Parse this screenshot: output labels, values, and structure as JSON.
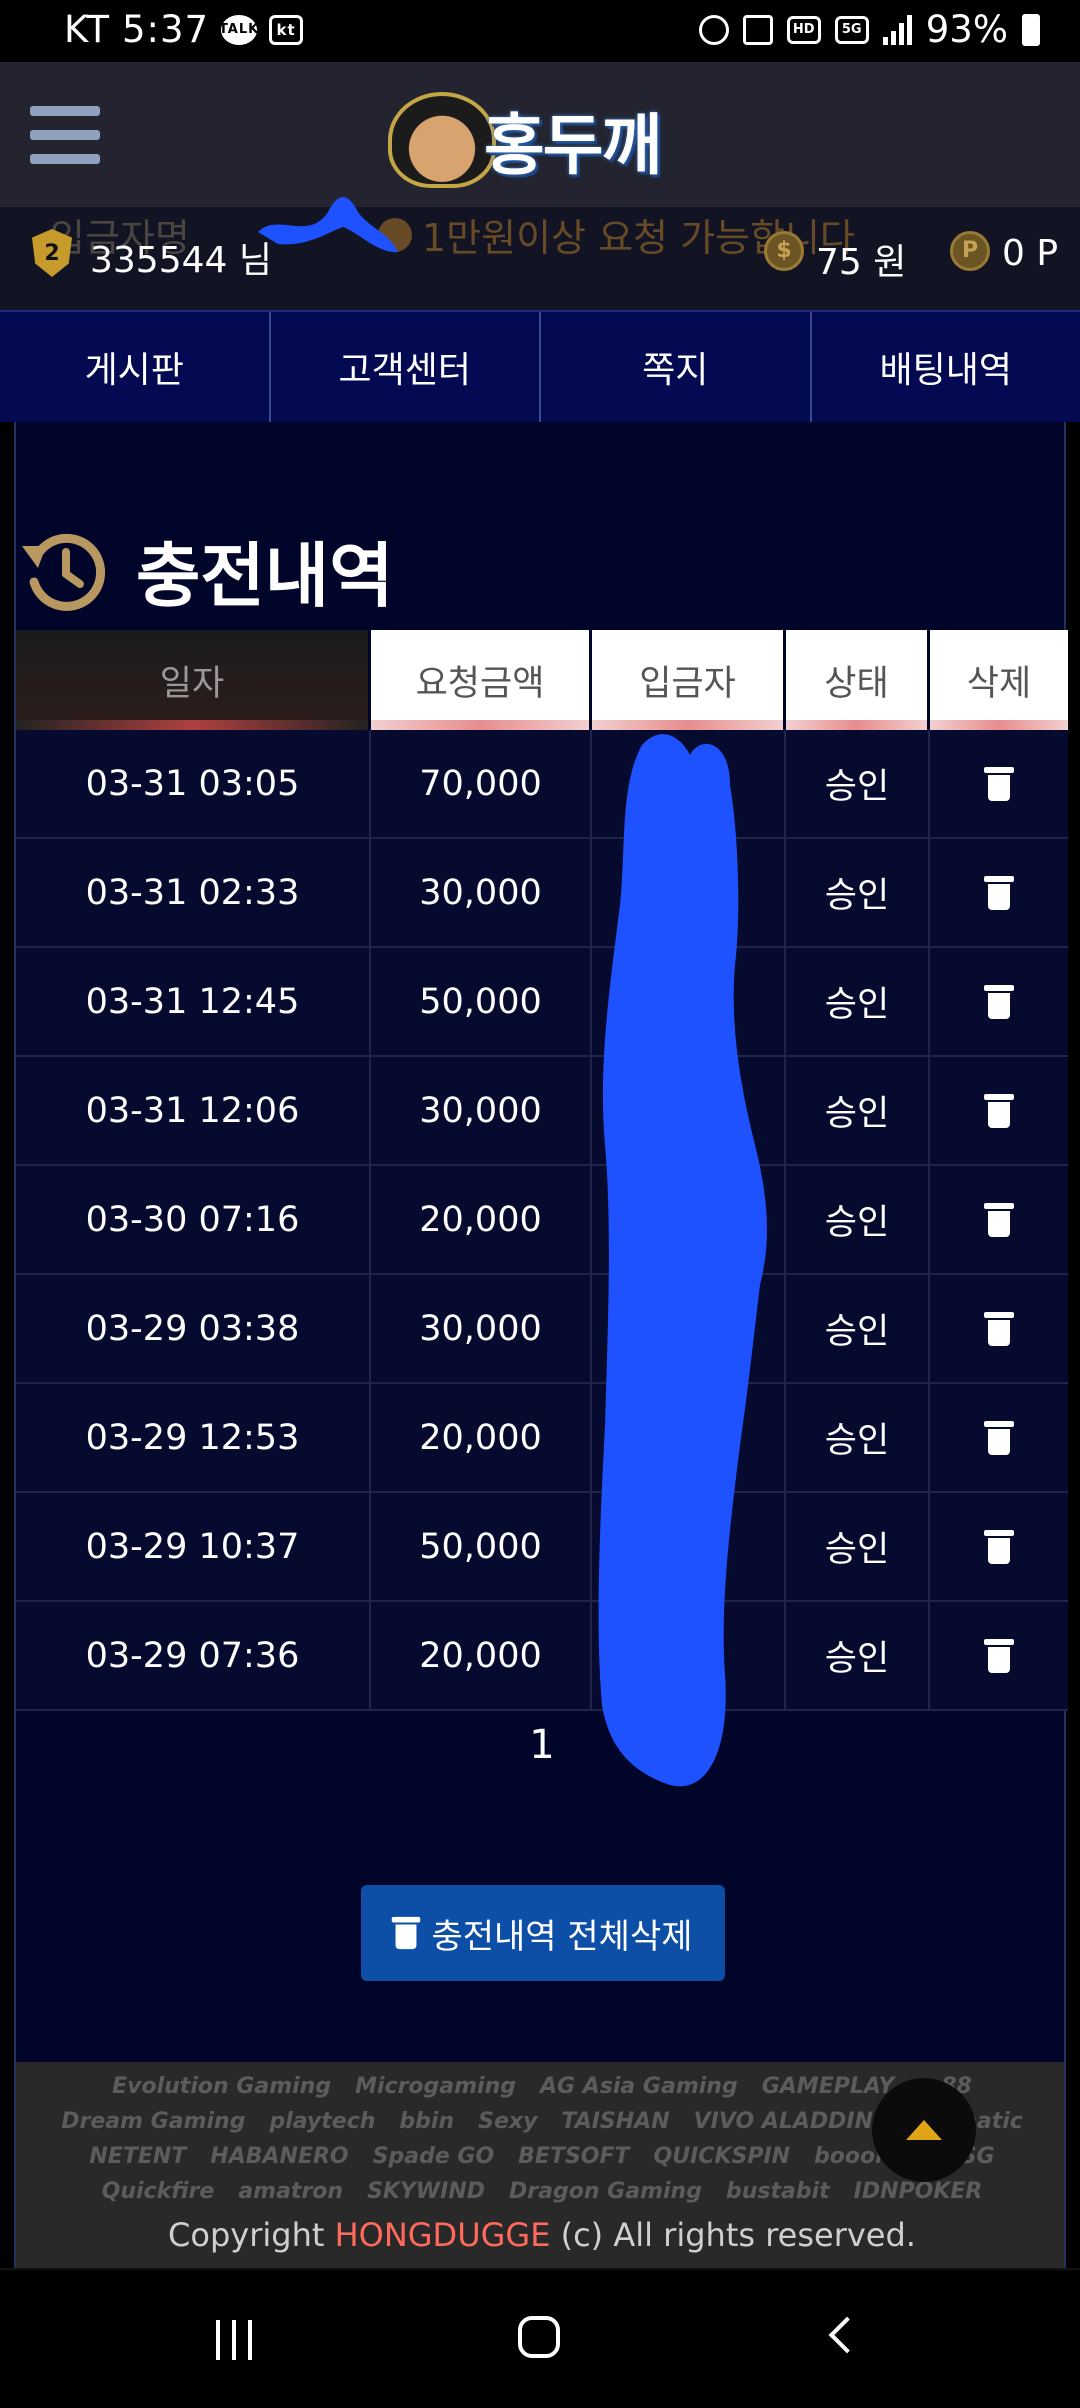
{
  "status_bar": {
    "carrier": "KT",
    "time": "5:37",
    "left_badges": [
      "TALK",
      "kt"
    ],
    "network": "5G",
    "hd": "HD",
    "battery": "93%"
  },
  "header": {
    "logo_text": "홍두깨"
  },
  "user_bar": {
    "faded_label": "입금자명",
    "faded_notice": "1만원이상 요청 가능합니다",
    "level": "2",
    "user_id": "335544 님",
    "coin_symbol": "$",
    "money": "75 원",
    "point_symbol": "P",
    "points": "0 P"
  },
  "tabs": [
    "게시판",
    "고객센터",
    "쪽지",
    "배팅내역"
  ],
  "page": {
    "title": "충전내역"
  },
  "table": {
    "headers": [
      "일자",
      "요청금액",
      "입금자",
      "상태",
      "삭제"
    ],
    "rows": [
      {
        "date": "03-31 03:05",
        "amount": "70,000",
        "depositor": "",
        "status": "승인"
      },
      {
        "date": "03-31 02:33",
        "amount": "30,000",
        "depositor": "",
        "status": "승인"
      },
      {
        "date": "03-31 12:45",
        "amount": "50,000",
        "depositor": "",
        "status": "승인"
      },
      {
        "date": "03-31 12:06",
        "amount": "30,000",
        "depositor": "",
        "status": "승인"
      },
      {
        "date": "03-30 07:16",
        "amount": "20,000",
        "depositor": "",
        "status": "승인"
      },
      {
        "date": "03-29 03:38",
        "amount": "30,000",
        "depositor": "",
        "status": "승인"
      },
      {
        "date": "03-29 12:53",
        "amount": "20,000",
        "depositor": "",
        "status": "승인"
      },
      {
        "date": "03-29 10:37",
        "amount": "50,000",
        "depositor": "",
        "status": "승인"
      },
      {
        "date": "03-29 07:36",
        "amount": "20,000",
        "depositor": "",
        "status": "승인"
      }
    ]
  },
  "pagination": {
    "current": "1"
  },
  "delete_all_label": "충전내역 전체삭제",
  "footer": {
    "providers": [
      "Evolution Gaming",
      "Microgaming",
      "AG Asia Gaming",
      "GAMEPLAY",
      "m88",
      "Dream Gaming",
      "playtech",
      "bbin",
      "Sexy",
      "TAISHAN",
      "VIVO ALADDIN",
      "Pragmatic",
      "NETENT",
      "HABANERO",
      "Spade GO",
      "BETSOFT",
      "QUICKSPIN",
      "booongo",
      "TSG",
      "Quickfire",
      "amatron",
      "SKYWIND",
      "Dragon Gaming",
      "bustabit",
      "IDNPOKER"
    ],
    "copyright_prefix": "Copyright",
    "brand": "HONGDUGGE",
    "copyright_suffix": "(c) All rights reserved."
  },
  "colors": {
    "tab_bg": "#030a52",
    "main_bg": "#02052a",
    "button_blue": "#0d4ea6",
    "brand_red": "#ff6a5c",
    "top_arrow": "#e0a417",
    "scribble": "#1f52ff"
  },
  "icons": {
    "menu": "hamburger-icon",
    "history": "history-icon",
    "delete": "trash-icon",
    "top": "arrow-up-icon"
  }
}
